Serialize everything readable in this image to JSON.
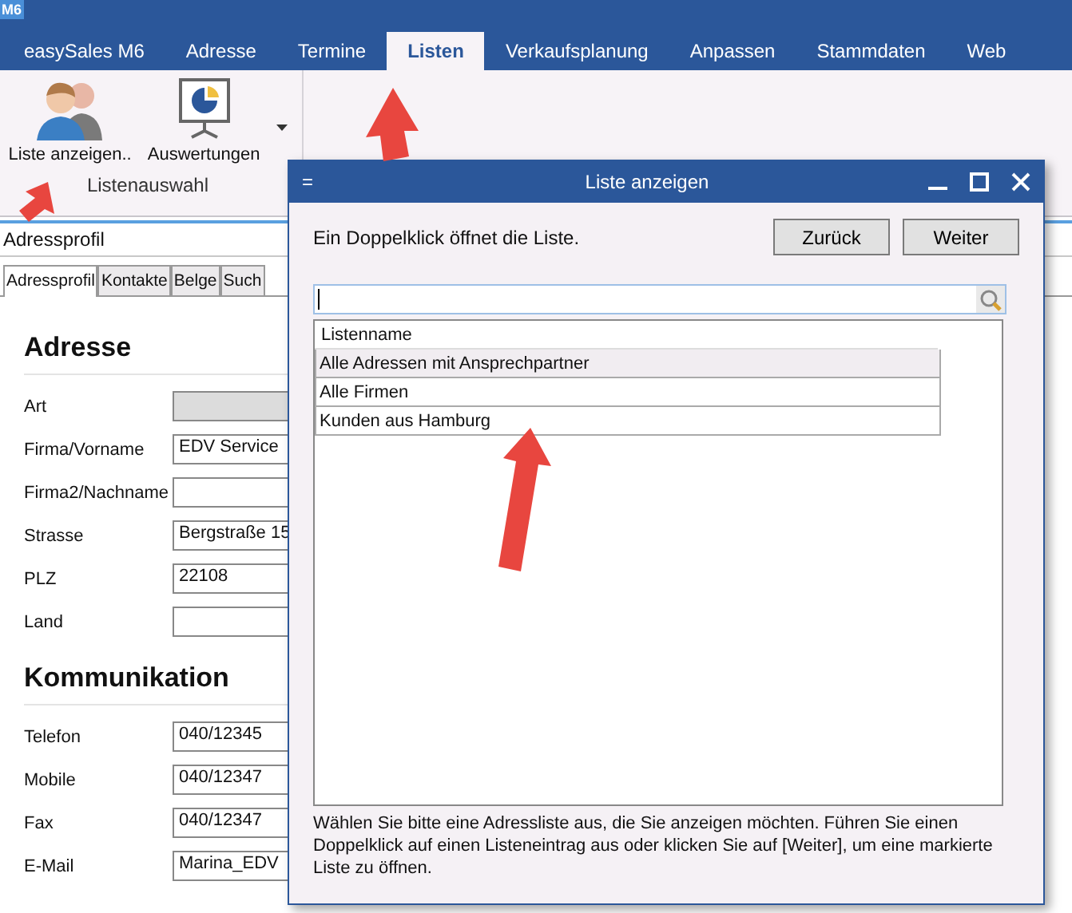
{
  "app": {
    "badge": "M6",
    "tabs": [
      {
        "label": "easySales M6",
        "selected": false
      },
      {
        "label": "Adresse",
        "selected": false
      },
      {
        "label": "Termine",
        "selected": false
      },
      {
        "label": "Listen",
        "selected": true
      },
      {
        "label": "Verkaufsplanung",
        "selected": false
      },
      {
        "label": "Anpassen",
        "selected": false
      },
      {
        "label": "Stammdaten",
        "selected": false
      },
      {
        "label": "Web",
        "selected": false
      }
    ],
    "ribbon": {
      "buttons": [
        {
          "label": "Liste anzeigen..",
          "kind": "people",
          "dropdown": false
        },
        {
          "label": "Auswertungen",
          "kind": "presentation",
          "dropdown": true
        }
      ],
      "group_label": "Listenauswahl"
    }
  },
  "panel": {
    "title": "Adressprofil",
    "tabs": [
      {
        "label": "Adressprofil",
        "selected": true
      },
      {
        "label": "Kontakte",
        "selected": false
      },
      {
        "label": "Belge",
        "selected": false
      },
      {
        "label": "Such",
        "selected": false
      }
    ],
    "sections": [
      {
        "heading": "Adresse",
        "fields": [
          {
            "label": "Art",
            "disabled": true
          },
          {
            "label": "Firma/Vorname",
            "value": "EDV Service",
            "disabled": false
          },
          {
            "label": "Firma2/Nachname",
            "disabled": false
          },
          {
            "label": "Strasse",
            "value": "Bergstraße 15",
            "disabled": false
          },
          {
            "label": "PLZ",
            "value": "22108",
            "disabled": false
          },
          {
            "label": "Land",
            "disabled": false
          }
        ]
      },
      {
        "heading": "Kommunikation",
        "fields": [
          {
            "label": "Telefon",
            "value": "040/12345",
            "disabled": false
          },
          {
            "label": "Mobile",
            "value": "040/12347",
            "disabled": false
          },
          {
            "label": "Fax",
            "value": "040/12347",
            "disabled": false
          },
          {
            "label": "E-Mail",
            "value": "Marina_EDV",
            "disabled": false
          }
        ]
      }
    ]
  },
  "dialog": {
    "menu_glyph": "=",
    "title": "Liste anzeigen",
    "hint": "Ein Doppelklick öffnet die Liste.",
    "buttons": [
      "Zurück",
      "Weiter"
    ],
    "search": {
      "focused": true
    },
    "list": {
      "column": "Listenname",
      "rows": [
        {
          "name": "Alle Adressen mit Ansprechpartner",
          "selected": true
        },
        {
          "name": "Alle Firmen",
          "selected": false
        },
        {
          "name": "Kunden aus Hamburg",
          "selected": false
        }
      ]
    },
    "footer": "Wählen Sie bitte eine Adressliste aus, die Sie anzeigen möchten. Führen Sie einen Doppelklick auf einen Listeneintrag aus oder klicken Sie auf [Weiter], um eine markierte Liste zu öffnen."
  }
}
